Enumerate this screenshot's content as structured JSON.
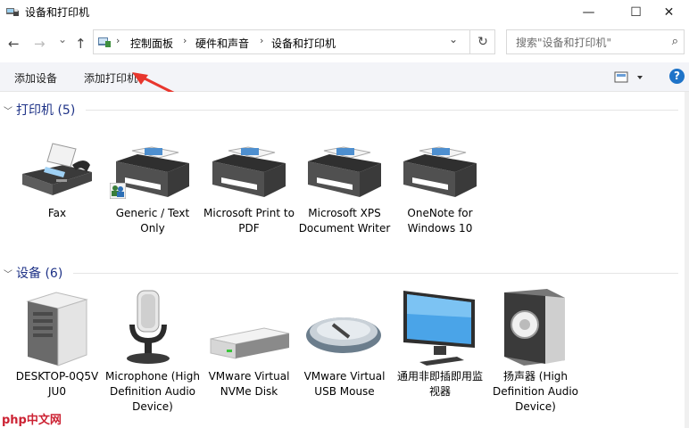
{
  "window": {
    "title": "设备和打印机",
    "minimize": "—",
    "maximize": "☐",
    "close": "✕"
  },
  "nav": {
    "back": "←",
    "forward": "→",
    "recent": "⌄",
    "up": "↑",
    "breadcrumb": [
      "控制面板",
      "硬件和声音",
      "设备和打印机"
    ],
    "separator": "›",
    "dropdown": "⌄",
    "refresh": "↻",
    "search_placeholder": "搜索\"设备和打印机\"",
    "search_icon": "⌕"
  },
  "commands": {
    "add_device": "添加设备",
    "add_printer": "添加打印机",
    "help": "?"
  },
  "annotation_arrow_color": "#e8362d",
  "printers": {
    "title": "打印机 (5)",
    "items": [
      {
        "label": "Fax",
        "icon": "fax-icon"
      },
      {
        "label": "Generic / Text Only",
        "icon": "printer-icon"
      },
      {
        "label": "Microsoft Print to PDF",
        "icon": "printer-icon"
      },
      {
        "label": "Microsoft XPS Document Writer",
        "icon": "printer-icon"
      },
      {
        "label": "OneNote for Windows 10",
        "icon": "printer-icon"
      }
    ]
  },
  "devices": {
    "title": "设备 (6)",
    "items": [
      {
        "label": "DESKTOP-0Q5V JU0",
        "icon": "computer-tower-icon"
      },
      {
        "label": "Microphone (High Definition Audio Device)",
        "icon": "microphone-icon"
      },
      {
        "label": "VMware Virtual NVMe Disk",
        "icon": "hard-disk-icon"
      },
      {
        "label": "VMware Virtual USB Mouse",
        "icon": "mouse-icon"
      },
      {
        "label": "通用非即插即用监视器",
        "icon": "monitor-icon"
      },
      {
        "label": "扬声器 (High Definition Audio Device)",
        "icon": "speaker-icon"
      }
    ]
  },
  "watermark": "php中文网"
}
